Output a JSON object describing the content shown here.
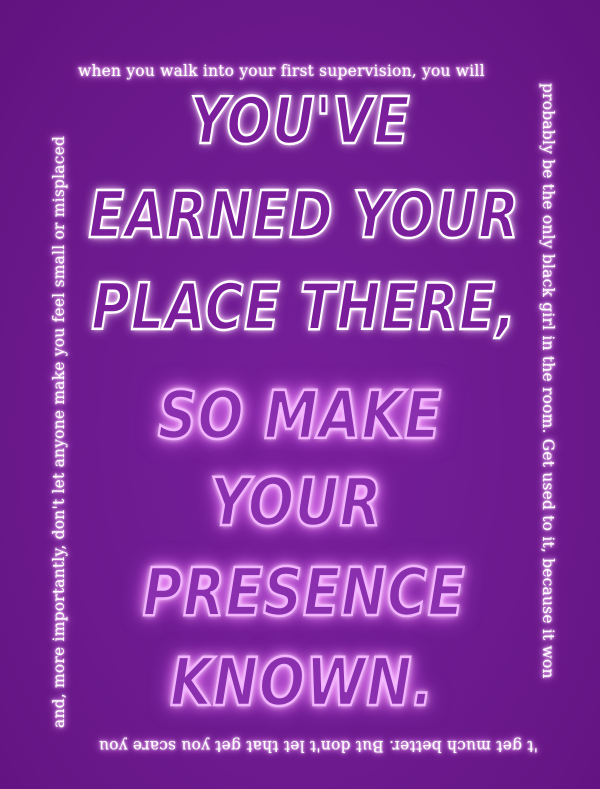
{
  "border": {
    "top": "when  you walk into your first supervision, you will",
    "right": "probably be the only black girl in the room. Get used to it, because it won",
    "bottom": "'t get much better. But don't let that get you scare you",
    "left": "and, more importantly, don't let anyone make you feel small or misplaced"
  },
  "headline": {
    "line1": "YOU'VE",
    "line2": "EARNED YOUR",
    "line3": "PLACE THERE,",
    "line4": "SO MAKE",
    "line5": "YOUR",
    "line6": "PRESENCE",
    "line7": "KNOWN."
  },
  "colors": {
    "background": "#6c1a8e",
    "outline_white": "#ffffff",
    "outline_pink": "#f3b4ff",
    "glow": "#e36cff"
  }
}
